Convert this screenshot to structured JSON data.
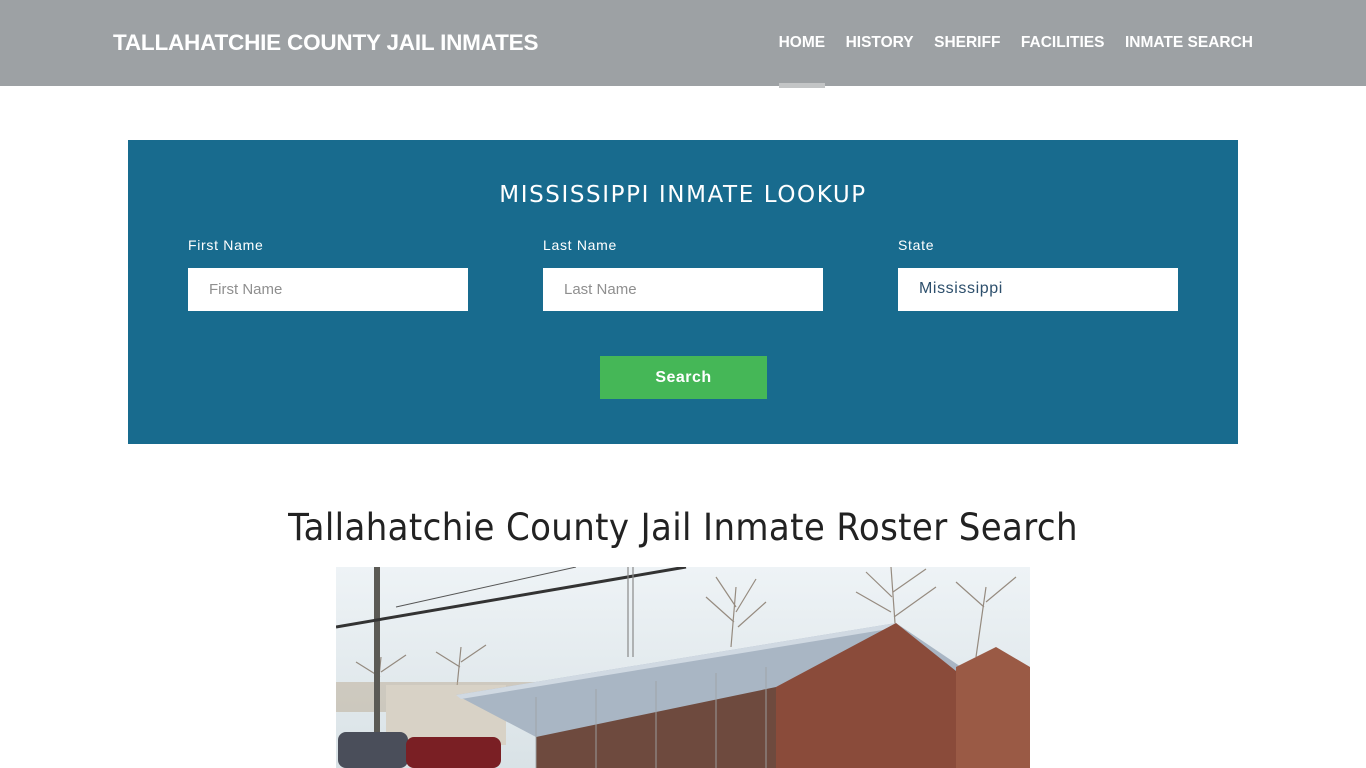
{
  "header": {
    "brand": "TALLAHATCHIE COUNTY JAIL INMATES",
    "nav": [
      {
        "label": "HOME",
        "active": true
      },
      {
        "label": "HISTORY",
        "active": false
      },
      {
        "label": "SHERIFF",
        "active": false
      },
      {
        "label": "FACILITIES",
        "active": false
      },
      {
        "label": "INMATE SEARCH",
        "active": false
      }
    ]
  },
  "lookup": {
    "title": "MISSISSIPPI INMATE LOOKUP",
    "first_name": {
      "label": "First Name",
      "placeholder": "First Name",
      "value": ""
    },
    "last_name": {
      "label": "Last Name",
      "placeholder": "Last Name",
      "value": ""
    },
    "state": {
      "label": "State",
      "value": "Mississippi"
    },
    "search_label": "Search"
  },
  "main": {
    "heading": "Tallahatchie County Jail Inmate Roster Search",
    "image_description": "Tallahatchie County Jail building exterior photo"
  },
  "colors": {
    "header_bg": "#9da1a4",
    "lookup_bg": "#186b8e",
    "search_button": "#45b757"
  }
}
